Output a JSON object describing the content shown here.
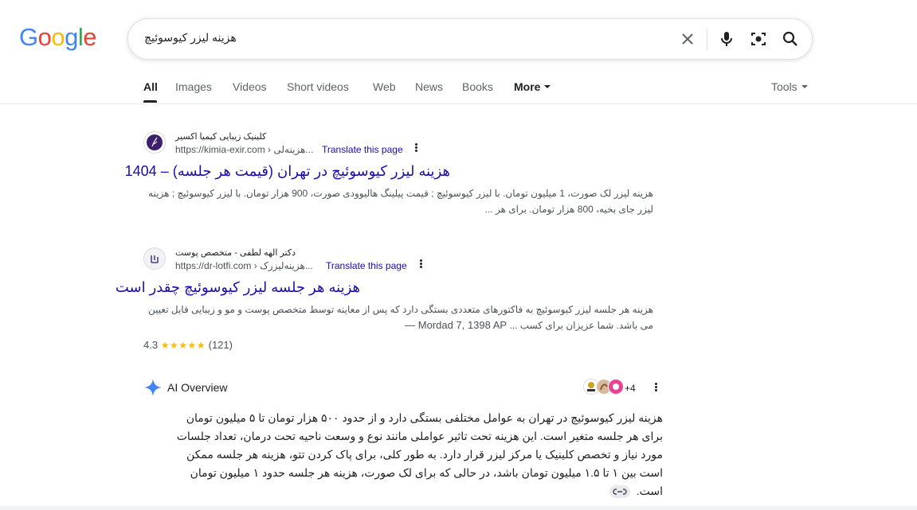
{
  "logo": {
    "letters": [
      "G",
      "o",
      "o",
      "g",
      "l",
      "e"
    ],
    "colors": [
      "#4285f4",
      "#ea4335",
      "#fbbc05",
      "#4285f4",
      "#34a853",
      "#ea4335"
    ]
  },
  "search": {
    "query": "هزینه لیزر کیوسوئیچ"
  },
  "tabs": {
    "all": "All",
    "images": "Images",
    "videos": "Videos",
    "short_videos": "Short videos",
    "web": "Web",
    "news": "News",
    "books": "Books",
    "more": "More",
    "tools": "Tools"
  },
  "results": [
    {
      "site_name": "کلینیک زیبایی کیمیا اکسیر",
      "url": "https://kimia-exir.com",
      "path": "› هزینه‌لی...",
      "translate": "Translate this page",
      "title": "هزینه لیزر کیوسوئیچ در تهران (قیمت هر جلسه) – 1404",
      "snippet": "هزینه لیزر لک صورت، 1 میلیون تومان. با لیزر کیوسوئیچ ; قیمت پیلینگ هالیوودی صورت، 900 هزار تومان. با لیزر کیوسوئیچ ; هزینه لیزر جای بخیه، 800 هزار تومان. برای هر ..."
    },
    {
      "site_name": "دکتر الهه لطفی - متخصص پوست",
      "url": "https://dr-lotfi.com",
      "path": "› هزینه‌لیزر‌ک...",
      "translate": "Translate this page",
      "title": "هزینه هر جلسه لیزر کیوسوئیچ چقدر است",
      "date": "Mordad 7, 1398 AP —",
      "snippet": "هزینه هر جلسه لیزر کیوسوئیچ به فاکتورهای متعددی بستگی دارد که پس از معاینه توسط متخصص پوست و مو و زیبایی قابل تعیین می باشد. شما عزیزان برای کسب ...",
      "rating": "4.3",
      "stars": "★★★★★",
      "reviews": "(121)"
    }
  ],
  "ai_overview": {
    "title": "AI Overview",
    "more_sources": "+4",
    "body": "هزینه لیزر کیوسوئیچ در تهران به عوامل مختلفی بستگی دارد و از حدود ۵۰۰ هزار تومان تا ۵ میلیون تومان برای هر جلسه متغیر است. این هزینه تحت تاثیر عواملی مانند نوع و وسعت ناحیه تحت درمان، تعداد جلسات مورد نیاز و تخصص کلینیک یا مرکز لیزر قرار دارد. به طور کلی، برای پاک کردن تتو، هزینه هر جلسه ممکن است بین ۱ تا ۱.۵ میلیون تومان باشد، در حالی که برای لک صورت، هزینه هر جلسه حدود ۱ میلیون تومان است."
  }
}
